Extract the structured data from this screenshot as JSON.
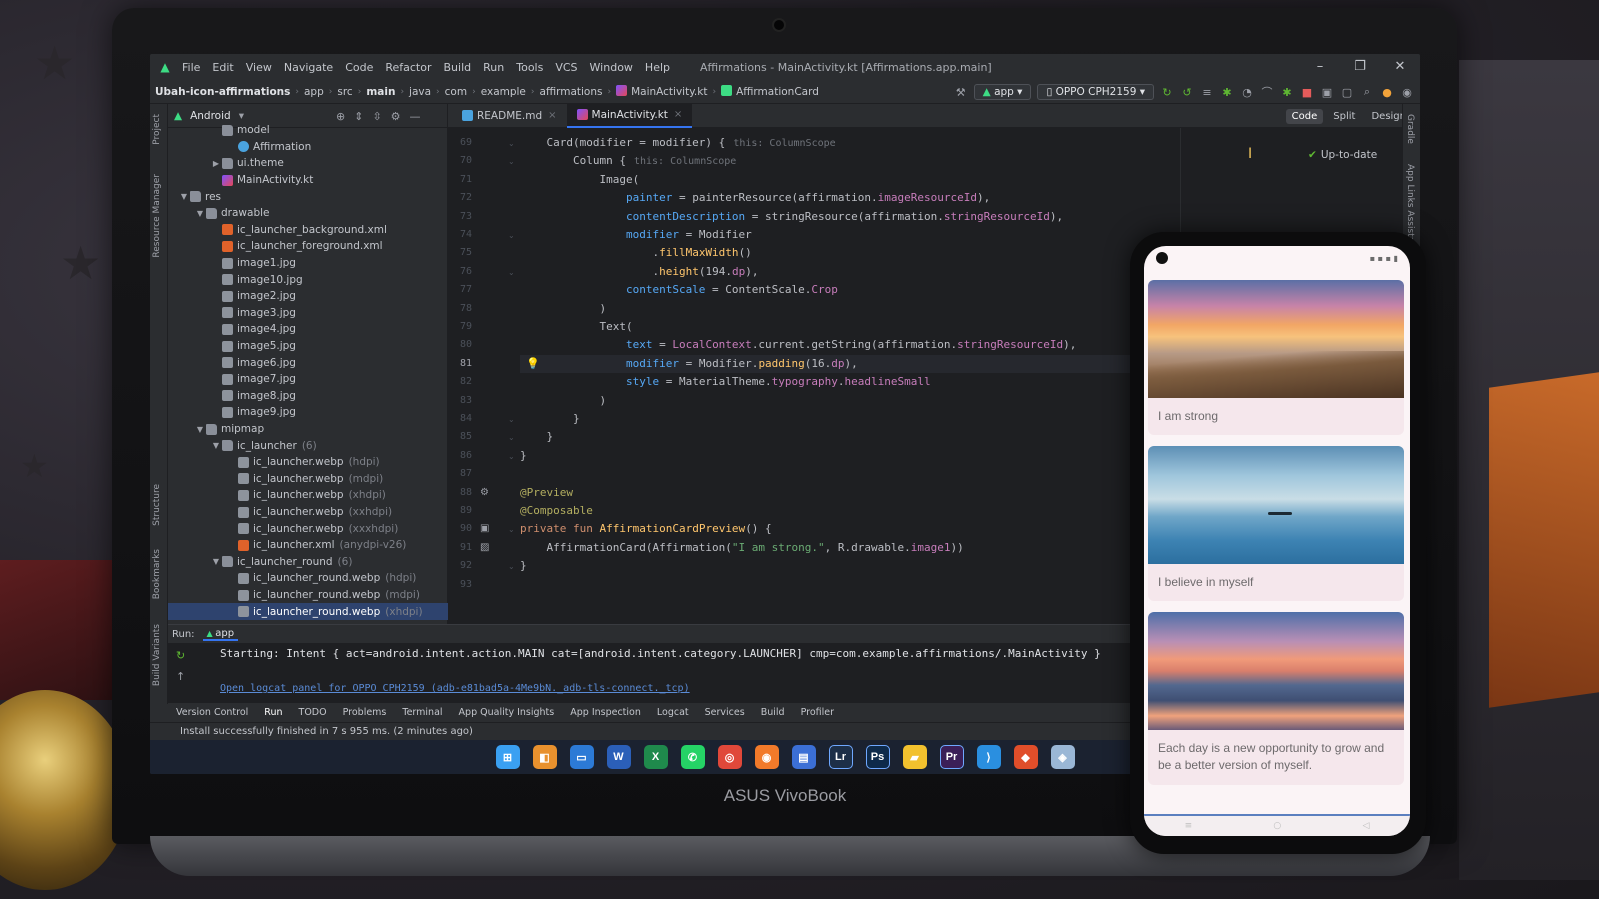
{
  "ide": {
    "menu": [
      "File",
      "Edit",
      "View",
      "Navigate",
      "Code",
      "Refactor",
      "Build",
      "Run",
      "Tools",
      "VCS",
      "Window",
      "Help"
    ],
    "window_title": "Affirmations - MainActivity.kt [Affirmations.app.main]",
    "breadcrumbs": [
      "Ubah-icon-affirmations",
      "app",
      "src",
      "main",
      "java",
      "com",
      "example",
      "affirmations",
      "MainActivity.kt",
      "AffirmationCard"
    ],
    "run_config": "app",
    "device": "OPPO CPH2159",
    "project_view": "Android",
    "tabs": [
      {
        "label": "README.md",
        "active": false
      },
      {
        "label": "MainActivity.kt",
        "active": true
      }
    ],
    "view_modes": [
      "Code",
      "Split",
      "Design"
    ],
    "preview_status": "Up-to-date",
    "left_strip": [
      "Project",
      "Resource Manager",
      "Structure",
      "Bookmarks",
      "Build Variants"
    ],
    "right_strip": [
      "Gradle",
      "App Links Assistant"
    ],
    "tree": [
      {
        "label": "model",
        "depth": 3,
        "type": "folder",
        "arrow": "",
        "dim": ""
      },
      {
        "label": "Affirmation",
        "depth": 4,
        "type": "cls",
        "arrow": "",
        "dim": ""
      },
      {
        "label": "ui.theme",
        "depth": 3,
        "type": "folder",
        "arrow": "▶",
        "dim": ""
      },
      {
        "label": "MainActivity.kt",
        "depth": 3,
        "type": "kt",
        "arrow": "",
        "dim": ""
      },
      {
        "label": "res",
        "depth": 1,
        "type": "folder",
        "arrow": "▼",
        "dim": ""
      },
      {
        "label": "drawable",
        "depth": 2,
        "type": "folder",
        "arrow": "▼",
        "dim": ""
      },
      {
        "label": "ic_launcher_background.xml",
        "depth": 3,
        "type": "xml",
        "arrow": "",
        "dim": ""
      },
      {
        "label": "ic_launcher_foreground.xml",
        "depth": 3,
        "type": "xml",
        "arrow": "",
        "dim": ""
      },
      {
        "label": "image1.jpg",
        "depth": 3,
        "type": "img",
        "arrow": "",
        "dim": ""
      },
      {
        "label": "image10.jpg",
        "depth": 3,
        "type": "img",
        "arrow": "",
        "dim": ""
      },
      {
        "label": "image2.jpg",
        "depth": 3,
        "type": "img",
        "arrow": "",
        "dim": ""
      },
      {
        "label": "image3.jpg",
        "depth": 3,
        "type": "img",
        "arrow": "",
        "dim": ""
      },
      {
        "label": "image4.jpg",
        "depth": 3,
        "type": "img",
        "arrow": "",
        "dim": ""
      },
      {
        "label": "image5.jpg",
        "depth": 3,
        "type": "img",
        "arrow": "",
        "dim": ""
      },
      {
        "label": "image6.jpg",
        "depth": 3,
        "type": "img",
        "arrow": "",
        "dim": ""
      },
      {
        "label": "image7.jpg",
        "depth": 3,
        "type": "img",
        "arrow": "",
        "dim": ""
      },
      {
        "label": "image8.jpg",
        "depth": 3,
        "type": "img",
        "arrow": "",
        "dim": ""
      },
      {
        "label": "image9.jpg",
        "depth": 3,
        "type": "img",
        "arrow": "",
        "dim": ""
      },
      {
        "label": "mipmap",
        "depth": 2,
        "type": "folder",
        "arrow": "▼",
        "dim": ""
      },
      {
        "label": "ic_launcher",
        "depth": 3,
        "type": "folder",
        "arrow": "▼",
        "dim": "(6)"
      },
      {
        "label": "ic_launcher.webp",
        "depth": 4,
        "type": "img",
        "arrow": "",
        "dim": "(hdpi)"
      },
      {
        "label": "ic_launcher.webp",
        "depth": 4,
        "type": "img",
        "arrow": "",
        "dim": "(mdpi)"
      },
      {
        "label": "ic_launcher.webp",
        "depth": 4,
        "type": "img",
        "arrow": "",
        "dim": "(xhdpi)"
      },
      {
        "label": "ic_launcher.webp",
        "depth": 4,
        "type": "img",
        "arrow": "",
        "dim": "(xxhdpi)"
      },
      {
        "label": "ic_launcher.webp",
        "depth": 4,
        "type": "img",
        "arrow": "",
        "dim": "(xxxhdpi)"
      },
      {
        "label": "ic_launcher.xml",
        "depth": 4,
        "type": "xml",
        "arrow": "",
        "dim": "(anydpi-v26)"
      },
      {
        "label": "ic_launcher_round",
        "depth": 3,
        "type": "folder",
        "arrow": "▼",
        "dim": "(6)"
      },
      {
        "label": "ic_launcher_round.webp",
        "depth": 4,
        "type": "img",
        "arrow": "",
        "dim": "(hdpi)"
      },
      {
        "label": "ic_launcher_round.webp",
        "depth": 4,
        "type": "img",
        "arrow": "",
        "dim": "(mdpi)"
      },
      {
        "label": "ic_launcher_round.webp",
        "depth": 4,
        "type": "img",
        "arrow": "",
        "dim": "(xhdpi)",
        "selected": true
      }
    ],
    "code": [
      {
        "n": "69",
        "segs": [
          [
            "    Card(modifier = modifier) {",
            "#bcbec4"
          ]
        ],
        "hint": "this: ColumnScope"
      },
      {
        "n": "70",
        "segs": [
          [
            "        Column {",
            "#bcbec4"
          ]
        ],
        "hint": "this: ColumnScope"
      },
      {
        "n": "71",
        "segs": [
          [
            "            Image(",
            "#bcbec4"
          ]
        ]
      },
      {
        "n": "72",
        "segs": [
          [
            "                painter",
            "#56a8f5"
          ],
          [
            " = painterResource(affirmation.",
            "#bcbec4"
          ],
          [
            "imageResourceId",
            "#c77dbb"
          ],
          [
            "),",
            "#bcbec4"
          ]
        ]
      },
      {
        "n": "73",
        "segs": [
          [
            "                contentDescription",
            "#56a8f5"
          ],
          [
            " = stringResource(affirmation.",
            "#bcbec4"
          ],
          [
            "stringResourceId",
            "#c77dbb"
          ],
          [
            "),",
            "#bcbec4"
          ]
        ]
      },
      {
        "n": "74",
        "segs": [
          [
            "                modifier",
            "#56a8f5"
          ],
          [
            " = Modifier",
            "#bcbec4"
          ]
        ]
      },
      {
        "n": "75",
        "segs": [
          [
            "                    .",
            "#bcbec4"
          ],
          [
            "fillMaxWidth",
            "#ffc66d"
          ],
          [
            "()",
            "#bcbec4"
          ]
        ]
      },
      {
        "n": "76",
        "segs": [
          [
            "                    .",
            "#bcbec4"
          ],
          [
            "height",
            "#ffc66d"
          ],
          [
            "(194.",
            "#bcbec4"
          ],
          [
            "dp",
            "#c77dbb"
          ],
          [
            "),",
            "#bcbec4"
          ]
        ]
      },
      {
        "n": "77",
        "segs": [
          [
            "                contentScale",
            "#56a8f5"
          ],
          [
            " = ContentScale.",
            "#bcbec4"
          ],
          [
            "Crop",
            "#c77dbb"
          ]
        ]
      },
      {
        "n": "78",
        "segs": [
          [
            "            )",
            "#bcbec4"
          ]
        ]
      },
      {
        "n": "79",
        "segs": [
          [
            "            Text(",
            "#bcbec4"
          ]
        ]
      },
      {
        "n": "80",
        "segs": [
          [
            "                text",
            "#56a8f5"
          ],
          [
            " = ",
            "#bcbec4"
          ],
          [
            "LocalContext",
            "#c77dbb"
          ],
          [
            ".current.getString(affirmation.",
            "#bcbec4"
          ],
          [
            "stringResourceId",
            "#c77dbb"
          ],
          [
            "),",
            "#bcbec4"
          ]
        ]
      },
      {
        "n": "81",
        "segs": [
          [
            "                modifier",
            "#56a8f5"
          ],
          [
            " = Modifier.",
            "#bcbec4"
          ],
          [
            "padding",
            "#ffc66d"
          ],
          [
            "(16.",
            "#bcbec4"
          ],
          [
            "dp",
            "#c77dbb"
          ],
          [
            "),",
            "#bcbec4"
          ]
        ],
        "current": true
      },
      {
        "n": "82",
        "segs": [
          [
            "                style",
            "#56a8f5"
          ],
          [
            " = MaterialTheme.",
            "#bcbec4"
          ],
          [
            "typography",
            "#c77dbb"
          ],
          [
            ".",
            "#bcbec4"
          ],
          [
            "headlineSmall",
            "#c77dbb"
          ]
        ]
      },
      {
        "n": "83",
        "segs": [
          [
            "            )",
            "#bcbec4"
          ]
        ]
      },
      {
        "n": "84",
        "segs": [
          [
            "        }",
            "#bcbec4"
          ]
        ]
      },
      {
        "n": "85",
        "segs": [
          [
            "    }",
            "#bcbec4"
          ]
        ]
      },
      {
        "n": "86",
        "segs": [
          [
            "}",
            "#bcbec4"
          ]
        ]
      },
      {
        "n": "87",
        "segs": [
          [
            "",
            "#bcbec4"
          ]
        ]
      },
      {
        "n": "88",
        "segs": [
          [
            "@Preview",
            "#b3ae60"
          ]
        ]
      },
      {
        "n": "89",
        "segs": [
          [
            "@Composable",
            "#b3ae60"
          ]
        ]
      },
      {
        "n": "90",
        "segs": [
          [
            "private fun ",
            "#cf8e6d"
          ],
          [
            "AffirmationCardPreview",
            "#ffc66d"
          ],
          [
            "() {",
            "#bcbec4"
          ]
        ]
      },
      {
        "n": "91",
        "segs": [
          [
            "    AffirmationCard(Affirmation(",
            "#bcbec4"
          ],
          [
            "\"I am strong.\"",
            "#6aab73"
          ],
          [
            ", R.drawable.",
            "#bcbec4"
          ],
          [
            "image1",
            "#c77dbb"
          ],
          [
            "))",
            "#bcbec4"
          ]
        ]
      },
      {
        "n": "92",
        "segs": [
          [
            "}",
            "#bcbec4"
          ]
        ]
      },
      {
        "n": "93",
        "segs": [
          [
            "",
            "#bcbec4"
          ]
        ]
      }
    ],
    "run": {
      "label": "Run:",
      "tab": "app",
      "console": "Starting: Intent { act=android.intent.action.MAIN cat=[android.intent.category.LAUNCHER] cmp=com.example.affirmations/.MainActivity }",
      "link": "Open logcat panel for OPPO CPH2159 (adb-e81bad5a-4Me9bN._adb-tls-connect._tcp)"
    },
    "tool_tabs": [
      "Version Control",
      "Run",
      "TODO",
      "Problems",
      "Terminal",
      "App Quality Insights",
      "App Inspection",
      "Logcat",
      "Services",
      "Build",
      "Profiler"
    ],
    "status": "Install successfully finished in 7 s 955 ms. (2 minutes ago)"
  },
  "taskbar": [
    "start",
    "widgets",
    "desktop",
    "word",
    "excel",
    "whatsapp",
    "chrome",
    "firefox",
    "store",
    "lr",
    "ps",
    "explorer",
    "pr",
    "vscode",
    "office",
    "studio"
  ],
  "laptop_brand": "ASUS VivoBook",
  "phone": {
    "cards": [
      {
        "text": "I am strong"
      },
      {
        "text": "I believe in myself"
      },
      {
        "text": "Each day is a new opportunity to grow and be a better version of myself."
      }
    ]
  }
}
